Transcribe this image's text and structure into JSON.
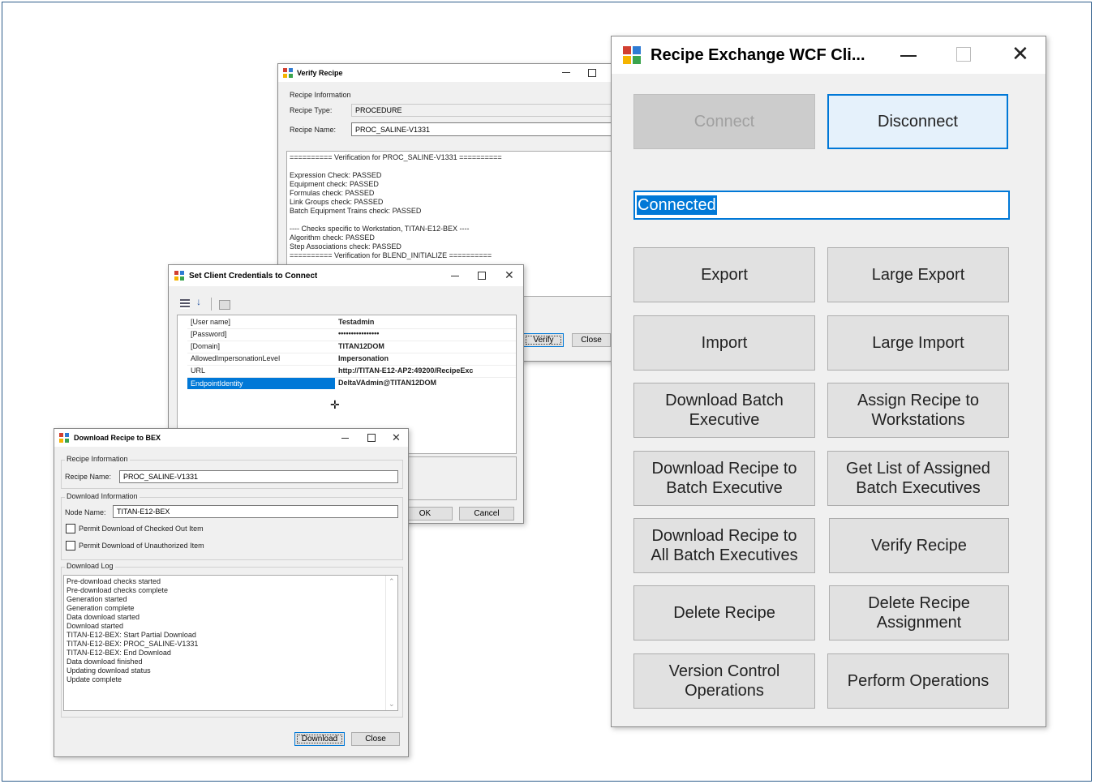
{
  "verify": {
    "title": "Verify Recipe",
    "recipe_info": "Recipe Information",
    "type_label": "Recipe Type:",
    "type_value": "PROCEDURE",
    "name_label": "Recipe Name:",
    "name_value": "PROC_SALINE-V1331",
    "log": "========== Verification for PROC_SALINE-V1331 ==========\n\nExpression Check: PASSED\nEquipment check: PASSED\nFormulas check: PASSED\nLink Groups check: PASSED\nBatch Equipment Trains check: PASSED\n\n---- Checks specific to Workstation, TITAN-E12-BEX ----\nAlgorithm check: PASSED\nStep Associations check: PASSED\n========== Verification for BLEND_INITIALIZE ==========",
    "verify_btn": "Verify",
    "close_btn": "Close"
  },
  "credentials": {
    "title": "Set Client Credentials to Connect",
    "props": [
      {
        "name": "[User name]",
        "value": "Testadmin"
      },
      {
        "name": "[Password]",
        "value": "••••••••••••••••"
      },
      {
        "name": "[Domain]",
        "value": "TITAN12DOM"
      },
      {
        "name": "AllowedImpersonationLevel",
        "value": "Impersonation"
      },
      {
        "name": "URL",
        "value": "http://TITAN-E12-AP2:49200/RecipeExc"
      },
      {
        "name": "EndpointIdentity",
        "value": "DeltaVAdmin@TITAN12DOM"
      }
    ],
    "ok_btn": "OK",
    "cancel_btn": "Cancel"
  },
  "download": {
    "title": "Download Recipe to BEX",
    "recipe_info": "Recipe Information",
    "name_label": "Recipe Name:",
    "name_value": "PROC_SALINE-V1331",
    "download_info": "Download Information",
    "node_label": "Node Name:",
    "node_value": "TITAN-E12-BEX",
    "permit_checked_out": "Permit Download of Checked Out Item",
    "permit_unauthorized": "Permit Download of Unauthorized Item",
    "log_label": "Download Log",
    "log": "Pre-download checks started\nPre-download checks complete\nGeneration started\nGeneration complete\nData download started\nDownload started\nTITAN-E12-BEX: Start Partial Download\nTITAN-E12-BEX: PROC_SALINE-V1331\nTITAN-E12-BEX: End Download\nData download finished\nUpdating download status\nUpdate complete",
    "download_btn": "Download",
    "close_btn": "Close"
  },
  "main": {
    "title": "Recipe Exchange WCF Cli...",
    "connect_btn": "Connect",
    "disconnect_btn": "Disconnect",
    "status": "Connected",
    "buttons": [
      "Export",
      "Large Export",
      "Import",
      "Large Import",
      "Download Batch\nExecutive",
      "Assign Recipe to\nWorkstations",
      "Download Recipe to\nBatch Executive",
      "Get List of Assigned\nBatch Executives",
      "Download Recipe to\nAll Batch Executives",
      "Verify Recipe",
      "Delete Recipe",
      "Delete Recipe\nAssignment",
      "Version Control\nOperations",
      "Perform Operations"
    ]
  },
  "icons": {
    "minimize": "minimize-icon",
    "maximize": "maximize-icon",
    "close": "close-icon",
    "accent": "#0078d7",
    "selection": "#0078d7"
  }
}
